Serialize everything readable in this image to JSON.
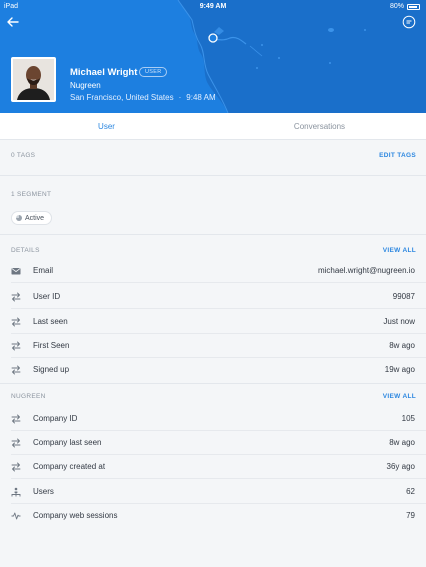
{
  "status_bar": {
    "device": "iPad",
    "time": "9:49 AM",
    "battery": "80%"
  },
  "user": {
    "name": "Michael Wright",
    "badge": "USER",
    "company": "Nugreen",
    "location": "San Francisco, United States",
    "local_time": "9:48 AM"
  },
  "tabs": [
    {
      "label": "User"
    },
    {
      "label": "Conversations"
    }
  ],
  "tags": {
    "label": "0 TAGS",
    "action": "EDIT TAGS"
  },
  "segments": {
    "label": "1 SEGMENT",
    "items": [
      "Active"
    ]
  },
  "details": {
    "label": "DETAILS",
    "action": "VIEW ALL",
    "rows": [
      {
        "icon": "mail-icon",
        "label": "Email",
        "value": "michael.wright@nugreen.io"
      },
      {
        "icon": "arrows-icon",
        "label": "User ID",
        "value": "99087"
      },
      {
        "icon": "arrows-icon",
        "label": "Last seen",
        "value": "Just now"
      },
      {
        "icon": "arrows-icon",
        "label": "First Seen",
        "value": "8w ago"
      },
      {
        "icon": "arrows-icon",
        "label": "Signed up",
        "value": "19w ago"
      }
    ]
  },
  "company_section": {
    "label": "NUGREEN",
    "action": "VIEW ALL",
    "rows": [
      {
        "icon": "arrows-icon",
        "label": "Company ID",
        "value": "105"
      },
      {
        "icon": "arrows-icon",
        "label": "Company last seen",
        "value": "8w ago"
      },
      {
        "icon": "arrows-icon",
        "label": "Company created at",
        "value": "36y ago"
      },
      {
        "icon": "users-icon",
        "label": "Users",
        "value": "62"
      },
      {
        "icon": "pulse-icon",
        "label": "Company web sessions",
        "value": "79"
      }
    ]
  },
  "colors": {
    "header": "#1d7fe0",
    "accent": "#2c87e0",
    "text": "#333a44",
    "muted": "#8a939e"
  }
}
